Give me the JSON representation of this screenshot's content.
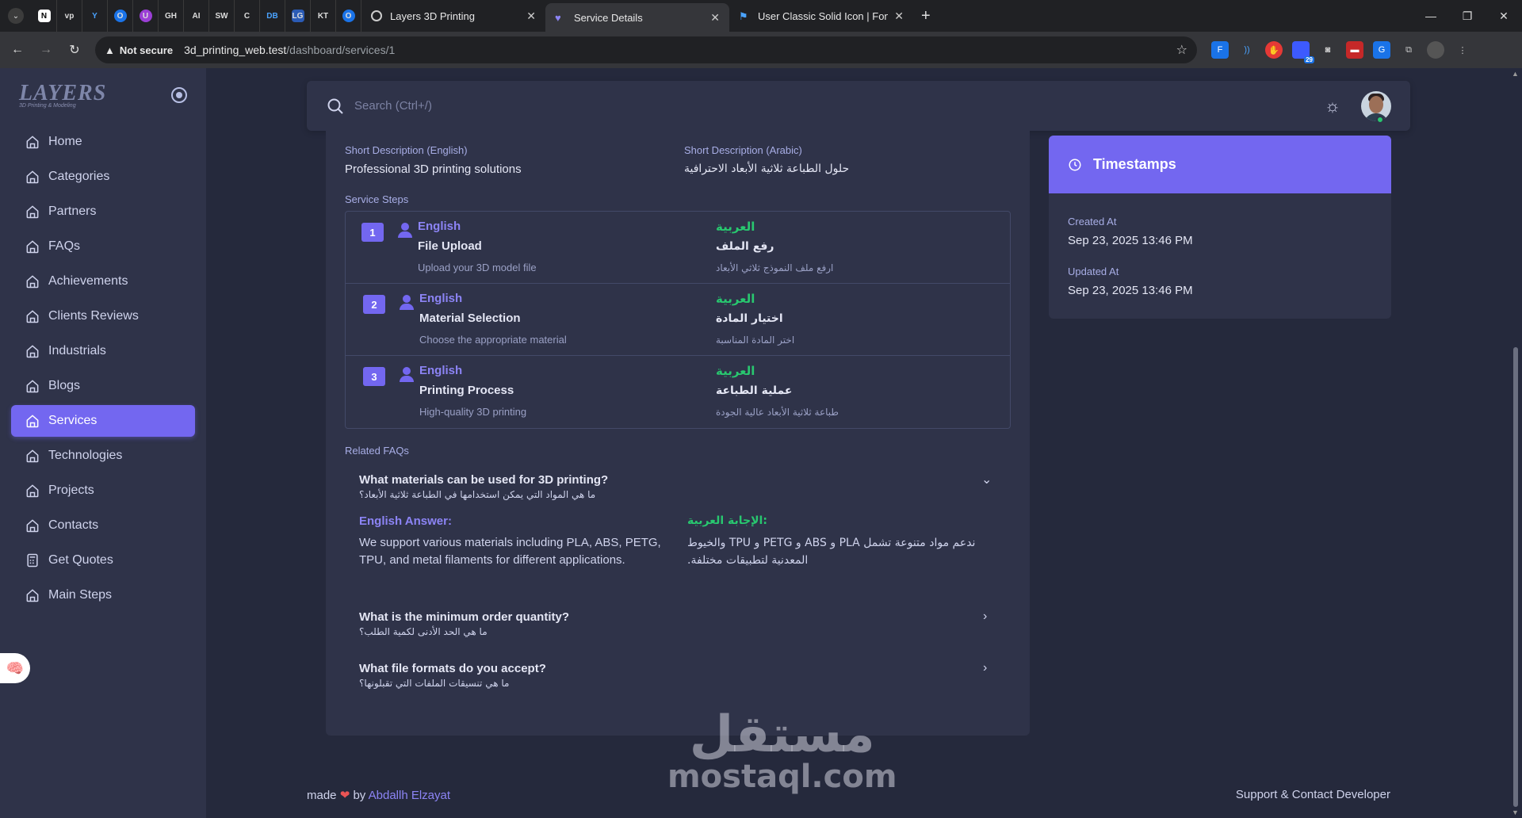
{
  "browser": {
    "pinned_tabs": [
      "N",
      "vp",
      "Y",
      "O",
      "U",
      "GH",
      "AI",
      "SW",
      "C",
      "DB",
      "LG",
      "KT",
      "O"
    ],
    "tabs": [
      {
        "title": "Layers 3D Printing"
      },
      {
        "title": "Service Details"
      },
      {
        "title": "User Classic Solid Icon | Font Aw"
      }
    ],
    "not_secure": "Not secure",
    "url_host": "3d_printing_web.test",
    "url_path": "/dashboard/services/1",
    "ext_badge": "29"
  },
  "sidebar": {
    "brand": "LAYERS",
    "brand_sub": "3D Printing & Modeling",
    "items": [
      {
        "label": "Home"
      },
      {
        "label": "Categories"
      },
      {
        "label": "Partners"
      },
      {
        "label": "FAQs"
      },
      {
        "label": "Achievements"
      },
      {
        "label": "Clients Reviews"
      },
      {
        "label": "Industrials"
      },
      {
        "label": "Blogs"
      },
      {
        "label": "Services",
        "active": true
      },
      {
        "label": "Technologies"
      },
      {
        "label": "Projects"
      },
      {
        "label": "Contacts"
      },
      {
        "label": "Get Quotes"
      },
      {
        "label": "Main Steps"
      }
    ]
  },
  "search": {
    "placeholder": "Search (Ctrl+/)"
  },
  "service": {
    "short_desc_en_label": "Short Description (English)",
    "short_desc_en": "Professional 3D printing solutions",
    "short_desc_ar_label": "Short Description (Arabic)",
    "short_desc_ar": "حلول الطباعة ثلاثية الأبعاد الاحترافية",
    "steps_label": "Service Steps",
    "steps": [
      {
        "num": "1",
        "en_label": "English",
        "title": "File Upload",
        "desc": "Upload your 3D model file",
        "ar_label": "العربية",
        "title_ar": "رفع الملف",
        "desc_ar": "ارفع ملف النموذج ثلاثي الأبعاد"
      },
      {
        "num": "2",
        "en_label": "English",
        "title": "Material Selection",
        "desc": "Choose the appropriate material",
        "ar_label": "العربية",
        "title_ar": "اختيار المادة",
        "desc_ar": "اختر المادة المناسبة"
      },
      {
        "num": "3",
        "en_label": "English",
        "title": "Printing Process",
        "desc": "High-quality 3D printing",
        "ar_label": "العربية",
        "title_ar": "عملية الطباعة",
        "desc_ar": "طباعة ثلاثية الأبعاد عالية الجودة"
      }
    ],
    "faqs_label": "Related FAQs",
    "faqs": [
      {
        "q": "What materials can be used for 3D printing?",
        "q_ar": "ما هي المواد التي يمكن استخدامها في الطباعة ثلاثية الأبعاد؟",
        "expanded": true,
        "answer_en_label": "English Answer:",
        "answer_en": "We support various materials including PLA, ABS, PETG, TPU, and metal filaments for different applications.",
        "answer_ar_label": "الإجابة العربية:",
        "answer_ar": "ندعم مواد متنوعة تشمل PLA و ABS و PETG و TPU والخيوط المعدنية لتطبيقات مختلفة."
      },
      {
        "q": "What is the minimum order quantity?",
        "q_ar": "ما هي الحد الأدنى لكمية الطلب؟",
        "expanded": false
      },
      {
        "q": "What file formats do you accept?",
        "q_ar": "ما هي تنسيقات الملفات التي تقبلونها؟",
        "expanded": false
      }
    ]
  },
  "timestamps": {
    "title": "Timestamps",
    "created_label": "Created At",
    "created": "Sep 23, 2025 13:46 PM",
    "updated_label": "Updated At",
    "updated": "Sep 23, 2025 13:46 PM"
  },
  "footer": {
    "made": "made",
    "by": "by",
    "author": "Abdallh Elzayat",
    "support": "Support & Contact Developer"
  },
  "watermark": {
    "ar": "مستقل",
    "latin": "mostaql.com"
  },
  "colors": {
    "primary": "#7367f0",
    "success": "#28c76f",
    "bg": "#25293c",
    "card": "#2f3349"
  }
}
